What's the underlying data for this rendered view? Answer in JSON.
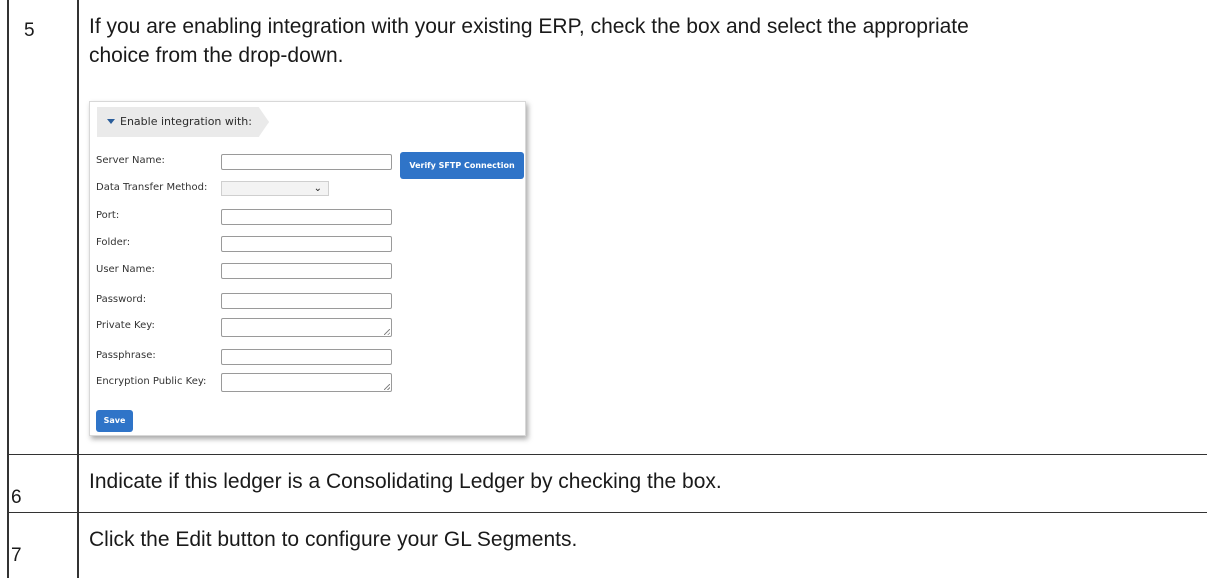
{
  "steps": [
    {
      "number": "5",
      "lines": [
        "If you are enabling integration with your existing ERP, check the box and select the appropriate",
        "choice from the drop-down."
      ]
    },
    {
      "number": "6",
      "text": "Indicate if this ledger is a Consolidating Ledger by checking the box."
    },
    {
      "number": "7",
      "text": "Click the Edit button to configure your GL Segments."
    }
  ],
  "form": {
    "panel_title": "Enable integration with:",
    "fields": {
      "server_name": "Server Name:",
      "data_transfer_method": "Data Transfer Method:",
      "port": "Port:",
      "folder": "Folder:",
      "user_name": "User Name:",
      "password": "Password:",
      "private_key": "Private Key:",
      "passphrase": "Passphrase:",
      "encryption_public_key": "Encryption Public Key:"
    },
    "verify_button": "Verify SFTP Connection",
    "save_button": "Save"
  },
  "icons": {
    "panel_toggle": "caret-down-icon",
    "select": "chevron-down-icon"
  },
  "colors": {
    "button_bg": "#2f74c8",
    "header_bg": "#eaeaea",
    "text": "#1a1a1a"
  }
}
